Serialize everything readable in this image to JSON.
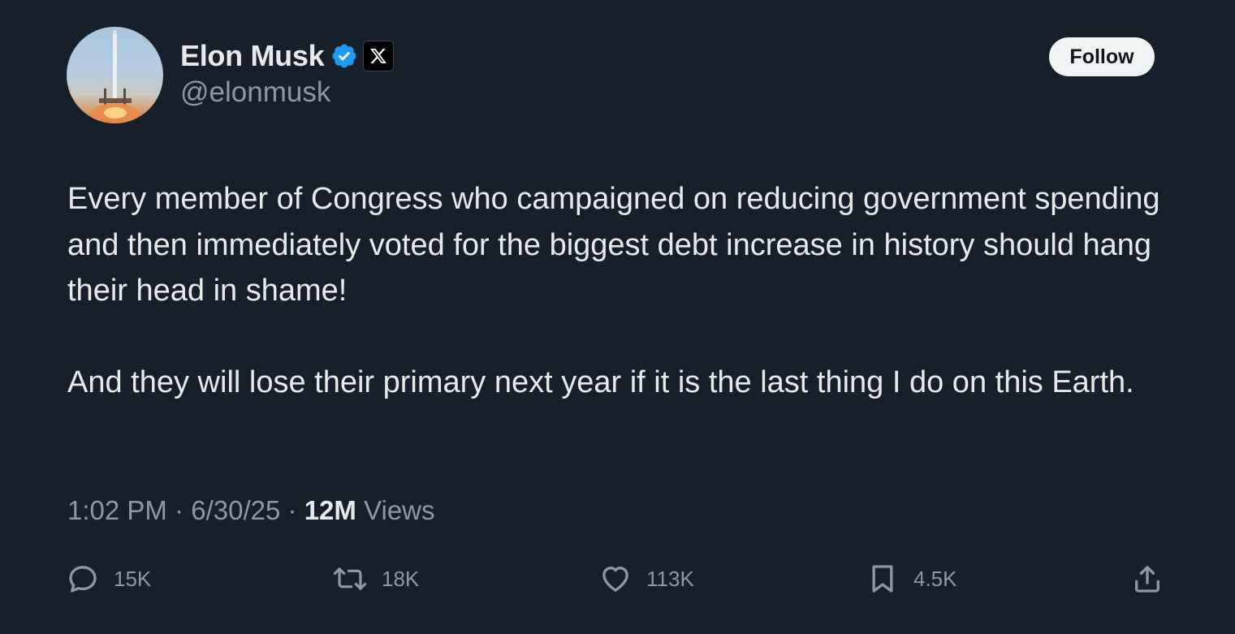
{
  "author": {
    "display_name": "Elon Musk",
    "handle": "@elonmusk",
    "verified_icon": "verified-badge-icon",
    "affiliate_icon": "x-logo-icon"
  },
  "follow_button": {
    "label": "Follow"
  },
  "tweet": {
    "paragraphs": [
      "Every member of Congress who campaigned on reducing government spending and then immediately voted for the biggest debt increase in history should hang their head in shame!",
      "And they will lose their primary next year if it is the last thing I do on this Earth."
    ]
  },
  "meta": {
    "time": "1:02 PM",
    "separator": "·",
    "date": "6/30/25",
    "views_count": "12M",
    "views_label": "Views"
  },
  "actions": {
    "reply": {
      "icon": "reply-icon",
      "count": "15K"
    },
    "repost": {
      "icon": "repost-icon",
      "count": "18K"
    },
    "like": {
      "icon": "heart-icon",
      "count": "113K"
    },
    "bookmark": {
      "icon": "bookmark-icon",
      "count": "4.5K"
    },
    "share": {
      "icon": "share-icon"
    }
  },
  "colors": {
    "background": "#17202a",
    "text_primary": "#e7e9ea",
    "text_secondary": "#8b98a5",
    "verified_blue": "#1d9bf0",
    "follow_bg": "#eff3f4"
  }
}
